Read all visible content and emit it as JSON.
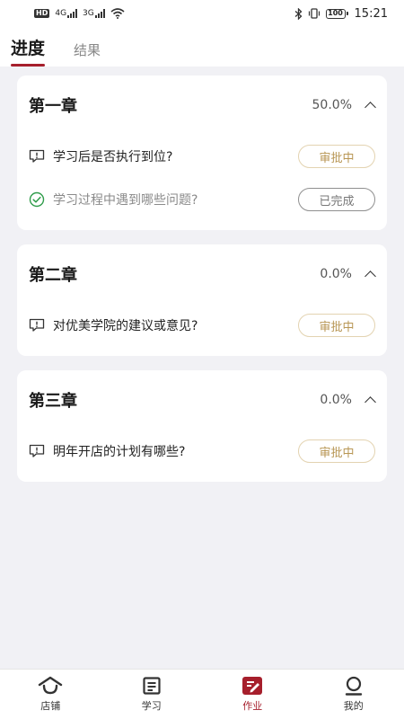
{
  "status_bar": {
    "left_badge": "HD",
    "net1": "4G",
    "net2": "3G",
    "battery": "100",
    "time": "15:21"
  },
  "tabs": [
    {
      "label": "进度",
      "active": true
    },
    {
      "label": "结果",
      "active": false
    }
  ],
  "chapters": [
    {
      "title": "第一章",
      "progress": "50.0%",
      "tasks": [
        {
          "text": "学习后是否执行到位?",
          "status": "审批中",
          "icon": "comment-alert-icon"
        },
        {
          "text": "学习过程中遇到哪些问题?",
          "status": "已完成",
          "icon": "check-circle-icon"
        }
      ]
    },
    {
      "title": "第二章",
      "progress": "0.0%",
      "tasks": [
        {
          "text": "对优美学院的建议或意见?",
          "status": "审批中",
          "icon": "comment-alert-icon"
        }
      ]
    },
    {
      "title": "第三章",
      "progress": "0.0%",
      "tasks": [
        {
          "text": "明年开店的计划有哪些?",
          "status": "审批中",
          "icon": "comment-alert-icon"
        }
      ]
    }
  ],
  "bottom_nav": [
    {
      "label": "店铺",
      "icon": "store-icon"
    },
    {
      "label": "学习",
      "icon": "study-icon"
    },
    {
      "label": "作业",
      "icon": "homework-icon",
      "active": true
    },
    {
      "label": "我的",
      "icon": "profile-icon"
    }
  ],
  "colors": {
    "accent": "#a61f2c",
    "pending": "#b89654",
    "done_check": "#2f9c4a",
    "background": "#f1f1f5"
  }
}
